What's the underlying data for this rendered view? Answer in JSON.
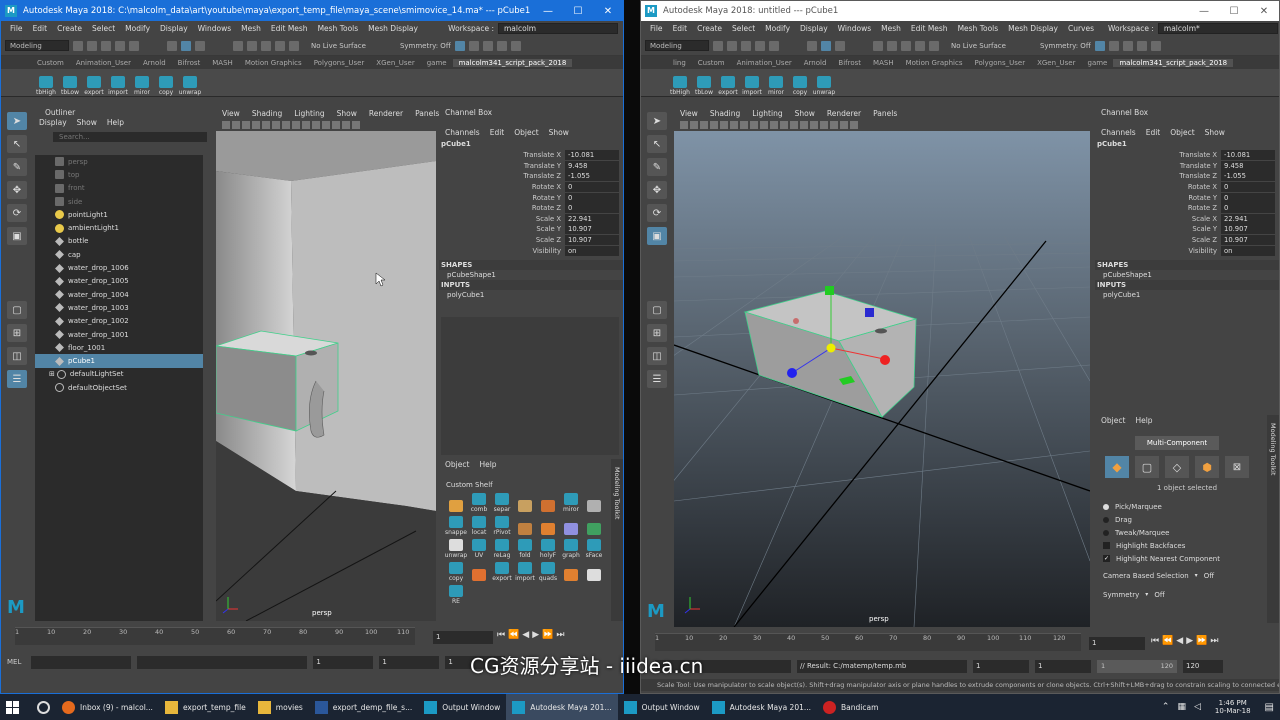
{
  "left": {
    "title": "Autodesk Maya 2018: C:\\malcolm_data\\art\\youtube\\maya\\export_temp_file\\maya_scene\\smimovice_14.ma*  ---  pCube1",
    "menus": [
      "File",
      "Edit",
      "Create",
      "Select",
      "Modify",
      "Display",
      "Windows",
      "Mesh",
      "Edit Mesh",
      "Mesh Tools",
      "Mesh Display"
    ],
    "workspace_label": "Workspace :",
    "workspace_value": "malcolm",
    "mode": "Modeling",
    "live_surface": "No Live Surface",
    "symmetry": "Symmetry: Off",
    "shelf_tabs": [
      "Custom",
      "Animation_User",
      "Arnold",
      "Bifrost",
      "MASH",
      "Motion Graphics",
      "Polygons_User",
      "XGen_User",
      "game",
      "malcolm341_script_pack_2018"
    ],
    "shelf_icons": [
      "tbHigh",
      "tbLow",
      "export",
      "import",
      "miror",
      "copy",
      "unwrap"
    ],
    "outliner": {
      "title": "Outliner",
      "menus": [
        "Display",
        "Show",
        "Help"
      ],
      "search_placeholder": "Search...",
      "items": [
        {
          "label": "persp",
          "icon": "camera-icon",
          "dim": true
        },
        {
          "label": "top",
          "icon": "camera-icon",
          "dim": true
        },
        {
          "label": "front",
          "icon": "camera-icon",
          "dim": true
        },
        {
          "label": "side",
          "icon": "camera-icon",
          "dim": true
        },
        {
          "label": "pointLight1",
          "icon": "light-icon"
        },
        {
          "label": "ambientLight1",
          "icon": "light-icon"
        },
        {
          "label": "bottle",
          "icon": "mesh-icon"
        },
        {
          "label": "cap",
          "icon": "mesh-icon"
        },
        {
          "label": "water_drop_1006",
          "icon": "mesh-icon"
        },
        {
          "label": "water_drop_1005",
          "icon": "mesh-icon"
        },
        {
          "label": "water_drop_1004",
          "icon": "mesh-icon"
        },
        {
          "label": "water_drop_1003",
          "icon": "mesh-icon"
        },
        {
          "label": "water_drop_1002",
          "icon": "mesh-icon"
        },
        {
          "label": "water_drop_1001",
          "icon": "mesh-icon"
        },
        {
          "label": "floor_1001",
          "icon": "mesh-icon"
        },
        {
          "label": "pCube1",
          "icon": "mesh-icon",
          "selected": true
        },
        {
          "label": "defaultLightSet",
          "icon": "set-icon"
        },
        {
          "label": "defaultObjectSet",
          "icon": "set-icon"
        }
      ]
    },
    "viewport": {
      "menus": [
        "View",
        "Shading",
        "Lighting",
        "Show",
        "Renderer",
        "Panels"
      ],
      "camera": "persp"
    },
    "channel_box": {
      "title": "Channel Box",
      "menus": [
        "Channels",
        "Edit",
        "Object",
        "Show"
      ],
      "object": "pCube1",
      "attrs": [
        {
          "label": "Translate X",
          "value": "-10.081"
        },
        {
          "label": "Translate Y",
          "value": "9.458"
        },
        {
          "label": "Translate Z",
          "value": "-1.055"
        },
        {
          "label": "Rotate X",
          "value": "0"
        },
        {
          "label": "Rotate Y",
          "value": "0"
        },
        {
          "label": "Rotate Z",
          "value": "0"
        },
        {
          "label": "Scale X",
          "value": "22.941"
        },
        {
          "label": "Scale Y",
          "value": "10.907"
        },
        {
          "label": "Scale Z",
          "value": "10.907"
        },
        {
          "label": "Visibility",
          "value": "on"
        }
      ],
      "shapes_label": "SHAPES",
      "shape": "pCubeShape1",
      "inputs_label": "INPUTS",
      "input": "polyCube1"
    },
    "custom_shelf": {
      "menus": [
        "Object",
        "Help"
      ],
      "title": "Custom Shelf",
      "side_label": "Modeling Toolkit",
      "icons": [
        "",
        "comb",
        "separ",
        "",
        "",
        "miror",
        "",
        "snappe",
        "locat",
        "rPivot",
        "",
        "",
        "",
        "",
        "unwrap",
        "UV",
        "reLag",
        "fold",
        "holyF",
        "graph",
        "sFace",
        "copy",
        "",
        "export",
        "import",
        "quads",
        "",
        "",
        "RE"
      ]
    },
    "timeline": {
      "ticks": [
        "1",
        "10",
        "20",
        "30",
        "40",
        "50",
        "60",
        "70",
        "80",
        "90",
        "100",
        "110"
      ],
      "current": "1"
    },
    "cmd": {
      "label": "MEL",
      "start": "1",
      "start2": "1",
      "range_start": "1"
    }
  },
  "right": {
    "title": "Autodesk Maya 2018: untitled  ---  pCube1",
    "menus": [
      "File",
      "Edit",
      "Create",
      "Select",
      "Modify",
      "Display",
      "Windows",
      "Mesh",
      "Edit Mesh",
      "Mesh Tools",
      "Mesh Display",
      "Curves"
    ],
    "workspace_label": "Workspace :",
    "workspace_value": "malcolm*",
    "mode": "Modeling",
    "live_surface": "No Live Surface",
    "symmetry": "Symmetry: Off",
    "shelf_tabs": [
      "ling",
      "Custom",
      "Animation_User",
      "Arnold",
      "Bifrost",
      "MASH",
      "Motion Graphics",
      "Polygons_User",
      "XGen_User",
      "game",
      "malcolm341_script_pack_2018"
    ],
    "shelf_icons": [
      "tbHigh",
      "tbLow",
      "export",
      "import",
      "miror",
      "copy",
      "unwrap"
    ],
    "viewport": {
      "menus": [
        "View",
        "Shading",
        "Lighting",
        "Show",
        "Renderer",
        "Panels"
      ],
      "camera": "persp"
    },
    "channel_box": {
      "title": "Channel Box",
      "menus": [
        "Channels",
        "Edit",
        "Object",
        "Show"
      ],
      "object": "pCube1",
      "attrs": [
        {
          "label": "Translate X",
          "value": "-10.081"
        },
        {
          "label": "Translate Y",
          "value": "9.458"
        },
        {
          "label": "Translate Z",
          "value": "-1.055"
        },
        {
          "label": "Rotate X",
          "value": "0"
        },
        {
          "label": "Rotate Y",
          "value": "0"
        },
        {
          "label": "Rotate Z",
          "value": "0"
        },
        {
          "label": "Scale X",
          "value": "22.941"
        },
        {
          "label": "Scale Y",
          "value": "10.907"
        },
        {
          "label": "Scale Z",
          "value": "10.907"
        },
        {
          "label": "Visibility",
          "value": "on"
        }
      ],
      "shapes_label": "SHAPES",
      "shape": "pCubeShape1",
      "inputs_label": "INPUTS",
      "input": "polyCube1"
    },
    "modeling_toolkit": {
      "menus": [
        "Object",
        "Help"
      ],
      "multi": "Multi-Component",
      "selected": "1 object selected",
      "side_label": "Modeling Toolkit",
      "options": [
        "Pick/Marquee",
        "Drag",
        "Tweak/Marquee"
      ],
      "checks": [
        "Highlight Backfaces",
        "Highlight Nearest Component"
      ],
      "camera_sel_label": "Camera Based Selection",
      "camera_sel_value": "Off",
      "symmetry_label": "Symmetry",
      "symmetry_value": "Off"
    },
    "timeline": {
      "ticks": [
        "1",
        "10",
        "20",
        "30",
        "40",
        "50",
        "60",
        "70",
        "80",
        "90",
        "100",
        "110",
        "120"
      ],
      "current": "1"
    },
    "cmd": {
      "result": "// Result: C:/matemp/temp.mb",
      "start": "1",
      "start2": "1",
      "range_start": "1",
      "range_end": "120",
      "end": "120"
    },
    "help": "Scale Tool: Use manipulator to scale object(s). Shift+drag manipulator axis or plane handles to extrude components or clone objects. Ctrl+Shift+LMB+drag to constrain scaling to connected edges. Use D or INSERT"
  },
  "watermark": "CG资源分享站 - iiidea.cn",
  "taskbar": {
    "items": [
      {
        "label": "Inbox (9) - malcol...",
        "icon": "firefox-icon"
      },
      {
        "label": "export_temp_file",
        "icon": "folder-icon"
      },
      {
        "label": "movies",
        "icon": "folder-icon"
      },
      {
        "label": "export_demp_file_s...",
        "icon": "word-icon"
      },
      {
        "label": "Output Window",
        "icon": "maya-icon"
      },
      {
        "label": "Autodesk Maya 201...",
        "icon": "maya-icon",
        "active": true
      },
      {
        "label": "Output Window",
        "icon": "maya-icon"
      },
      {
        "label": "Autodesk Maya 201...",
        "icon": "maya-icon"
      },
      {
        "label": "Bandicam",
        "icon": "record-icon"
      }
    ],
    "time": "1:46 PM",
    "date": "10-Mar-18"
  },
  "colors": {
    "accent": "#1a6fd8",
    "selection": "#5285a6",
    "cube_edge": "#3fd08a",
    "panel": "#444444"
  }
}
